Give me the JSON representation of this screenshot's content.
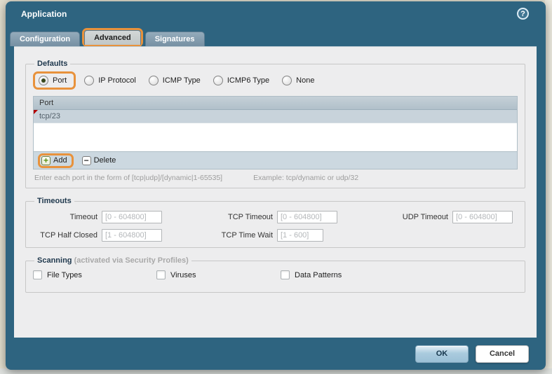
{
  "dialog": {
    "title": "Application"
  },
  "icons": {
    "help": "?",
    "add": "+",
    "delete": "−"
  },
  "tabs": [
    {
      "label": "Configuration",
      "active": false,
      "highlighted": false
    },
    {
      "label": "Advanced",
      "active": true,
      "highlighted": true
    },
    {
      "label": "Signatures",
      "active": false,
      "highlighted": false
    }
  ],
  "defaults": {
    "legend": "Defaults",
    "radios": [
      {
        "label": "Port",
        "selected": true,
        "highlighted": true
      },
      {
        "label": "IP Protocol",
        "selected": false
      },
      {
        "label": "ICMP Type",
        "selected": false
      },
      {
        "label": "ICMP6 Type",
        "selected": false
      },
      {
        "label": "None",
        "selected": false
      }
    ],
    "table": {
      "header": "Port",
      "rows": [
        "tcp/23"
      ]
    },
    "add_label": "Add",
    "delete_label": "Delete",
    "hint": "Enter each port in the form of [tcp|udp]/[dynamic|1-65535]",
    "hint_example": "Example: tcp/dynamic or udp/32"
  },
  "timeouts": {
    "legend": "Timeouts",
    "fields": [
      {
        "label": "Timeout",
        "placeholder": "[0 - 604800]",
        "value": ""
      },
      {
        "label": "TCP Timeout",
        "placeholder": "[0 - 604800]",
        "value": ""
      },
      {
        "label": "UDP Timeout",
        "placeholder": "[0 - 604800]",
        "value": ""
      },
      {
        "label": "TCP Half Closed",
        "placeholder": "[1 - 604800]",
        "value": ""
      },
      {
        "label": "TCP Time Wait",
        "placeholder": "[1 - 600]",
        "value": ""
      }
    ]
  },
  "scanning": {
    "legend": "Scanning",
    "legend_note": "(activated via Security Profiles)",
    "checkboxes": [
      {
        "label": "File Types",
        "checked": false
      },
      {
        "label": "Viruses",
        "checked": false
      },
      {
        "label": "Data Patterns",
        "checked": false
      }
    ]
  },
  "footer": {
    "ok_label": "OK",
    "cancel_label": "Cancel"
  },
  "colors": {
    "chrome_teal": "#2e6480",
    "annotation_orange": "#e8923c",
    "content_gray": "#ededee",
    "table_header": "#b8c4cd",
    "table_row_selected": "#c8d3db",
    "row_dirty_marker": "#b20000"
  }
}
